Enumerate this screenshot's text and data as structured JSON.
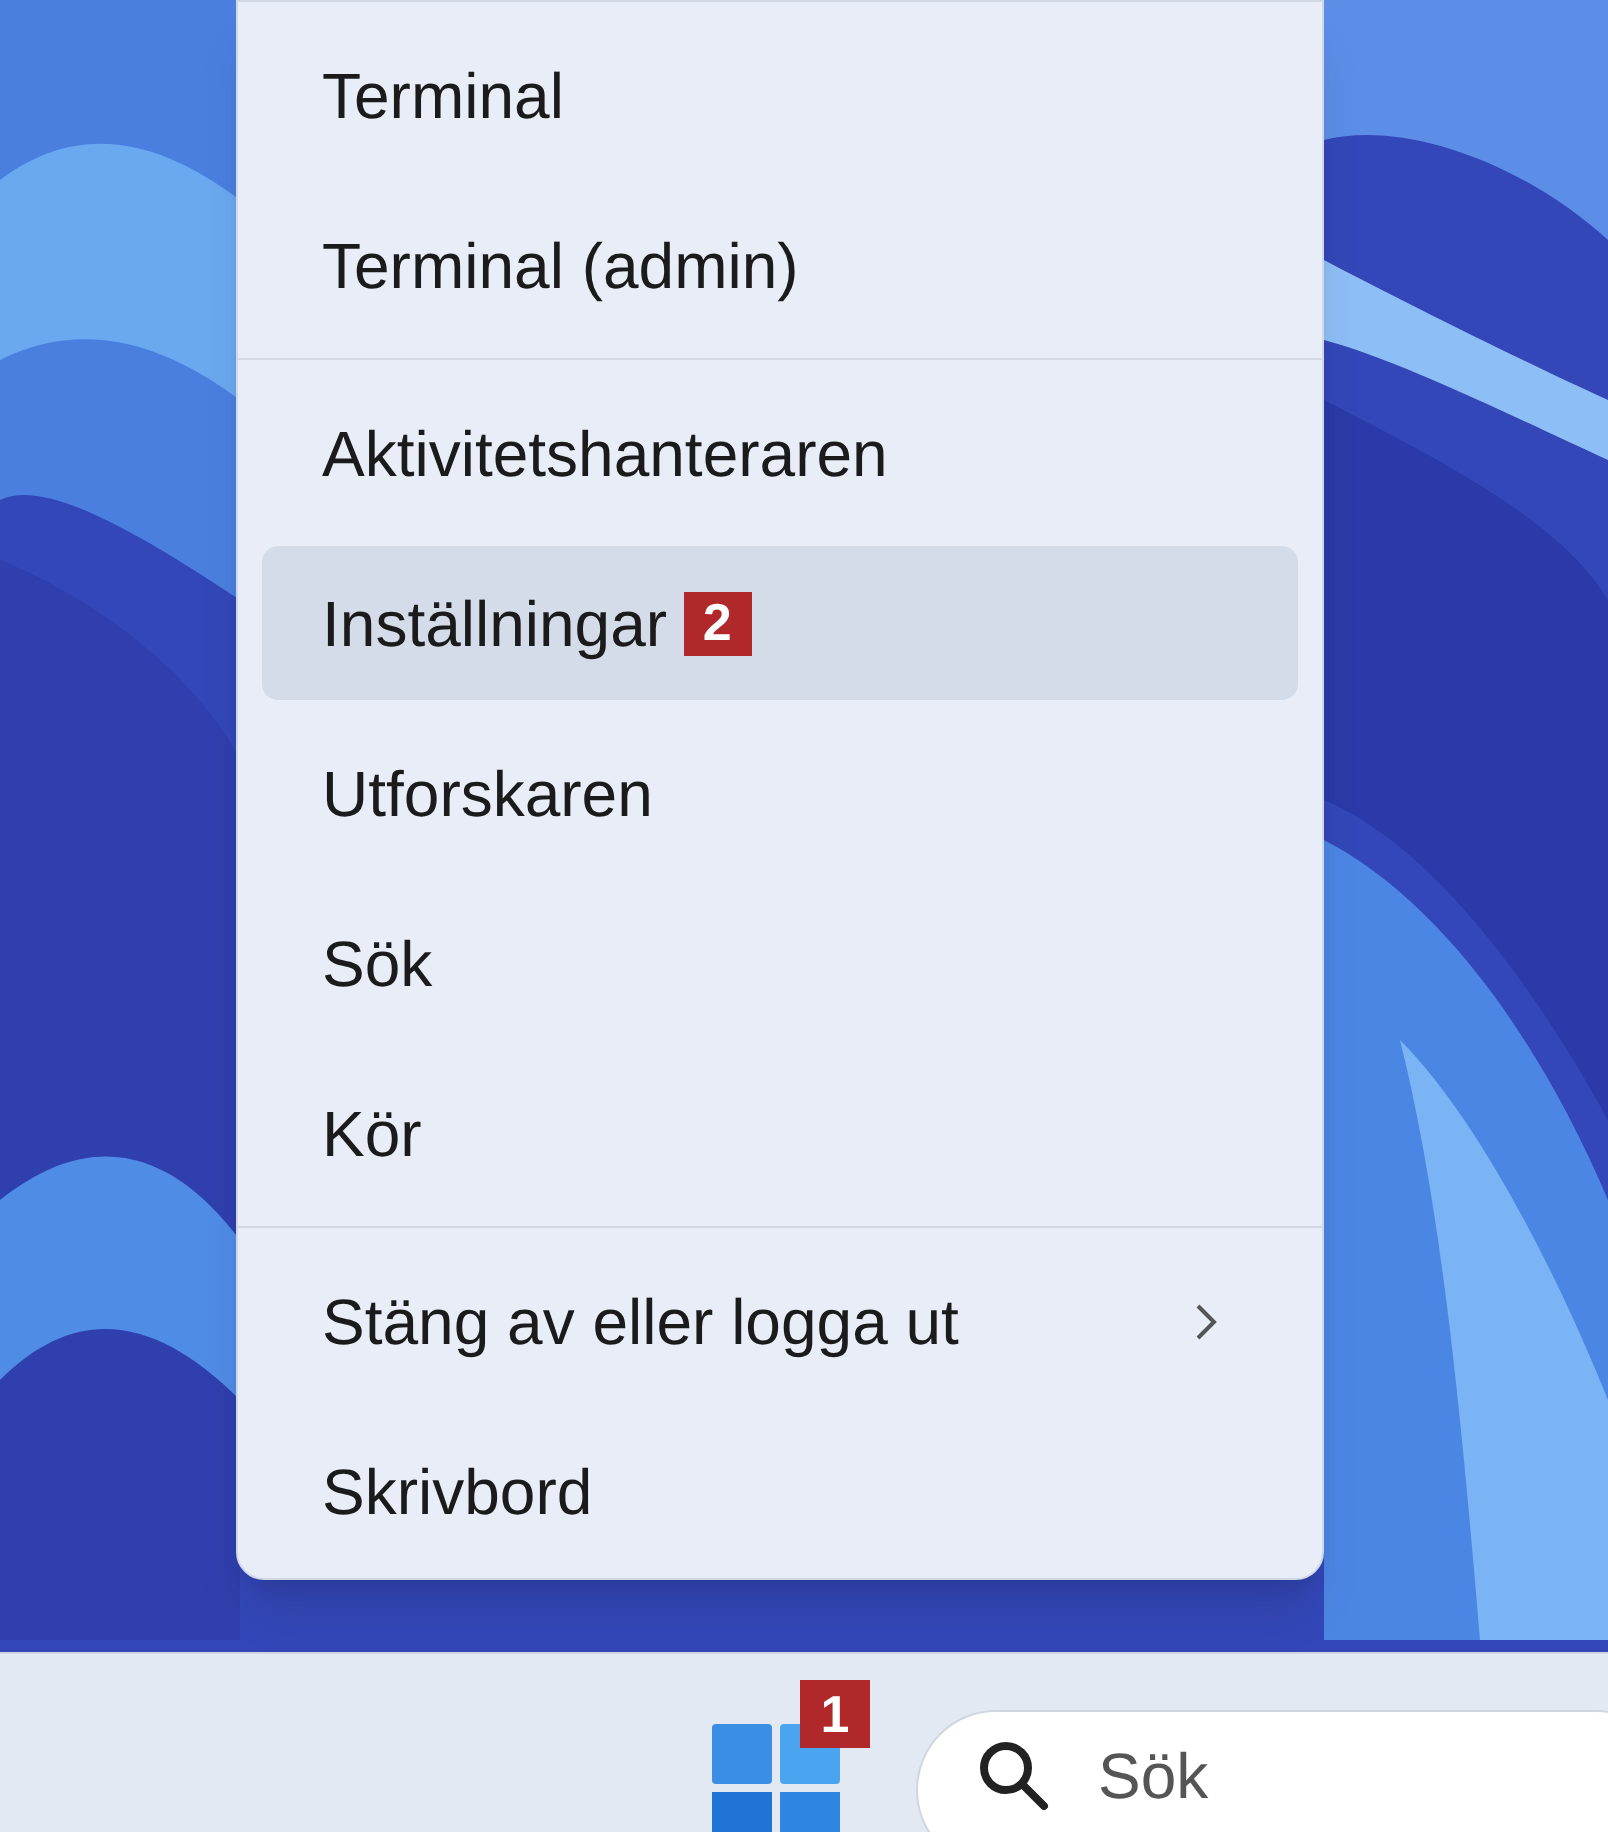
{
  "menu": {
    "items": [
      {
        "kind": "item",
        "label": "Terminal",
        "selected": false
      },
      {
        "kind": "item",
        "label": "Terminal (admin)",
        "selected": false
      },
      {
        "kind": "separator"
      },
      {
        "kind": "item",
        "label": "Aktivitetshanteraren",
        "selected": false
      },
      {
        "kind": "item",
        "label": "Inställningar",
        "selected": true,
        "badge": "2"
      },
      {
        "kind": "item",
        "label": "Utforskaren",
        "selected": false
      },
      {
        "kind": "item",
        "label": "Sök",
        "selected": false
      },
      {
        "kind": "item",
        "label": "Kör",
        "selected": false
      },
      {
        "kind": "separator"
      },
      {
        "kind": "submenu",
        "label": "Stäng av eller logga ut",
        "selected": false
      },
      {
        "kind": "item",
        "label": "Skrivbord",
        "selected": false
      }
    ]
  },
  "taskbar": {
    "start_badge": "1",
    "search": {
      "placeholder": "Sök"
    }
  }
}
